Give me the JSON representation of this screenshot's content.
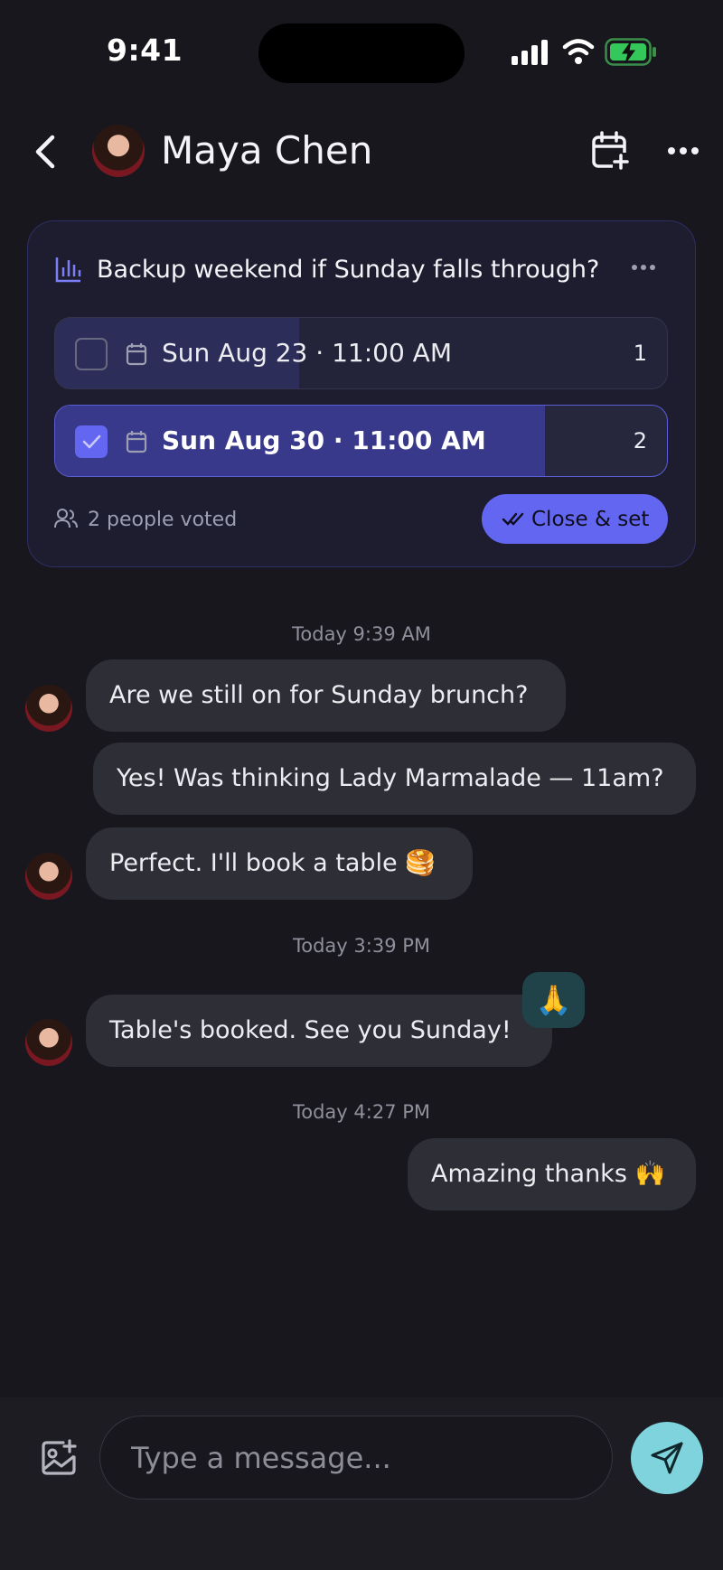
{
  "status_bar": {
    "time": "9:41"
  },
  "header": {
    "back_icon": "chevron-left-icon",
    "contact_name": "Maya Chen",
    "calendar_add_icon": "calendar-plus-icon",
    "more_icon": "more-horizontal-icon"
  },
  "poll": {
    "title": "Backup weekend if Sunday falls through?",
    "options": [
      {
        "label": "Sun Aug 23 · 11:00 AM",
        "votes": "1",
        "checked": false,
        "fill_fraction": 0.4
      },
      {
        "label": "Sun Aug 30 · 11:00 AM",
        "votes": "2",
        "checked": true,
        "fill_fraction": 0.8
      }
    ],
    "voters_text": "2 people voted",
    "close_button": "Close & set"
  },
  "messages": {
    "stamp_1": "Today 9:39 AM",
    "m1": "Are we still on for Sunday brunch?",
    "m2": "Yes! Was thinking Lady Marmalade — 11am?",
    "m3": "Perfect. I'll book a table 🥞",
    "stamp_2": "Today 3:39 PM",
    "m4": "Table's booked. See you Sunday!",
    "m4_reaction": "🙏",
    "stamp_3": "Today 4:27 PM",
    "m5": "Amazing thanks 🙌"
  },
  "composer": {
    "placeholder": "Type a message...",
    "attach_icon": "image-plus-icon",
    "send_icon": "send-icon"
  },
  "colors": {
    "accent": "#6366f1",
    "send": "#7fd3dc",
    "background": "#17171d",
    "bubble": "#2e2e36"
  }
}
